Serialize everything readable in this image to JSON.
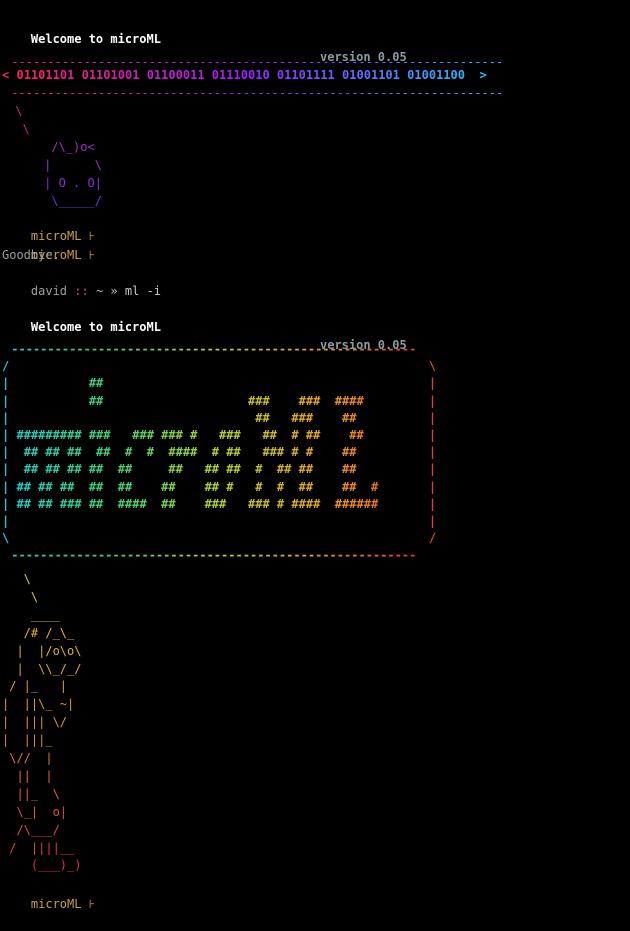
{
  "colors": {
    "background": "#000000",
    "text": "#c8c8c8",
    "prompt": "#c8a042",
    "version": "#8a9aa0",
    "banner_start": "#ff2060",
    "banner_mid": "#a020ff",
    "banner_end": "#20c0ff"
  },
  "session1": {
    "welcome": "Welcome to microML",
    "version": "version 0.05",
    "binary_line": "< 01101101 01101001 01100011 01110010 01101111 01001101 01001100  >",
    "dash_line": " --------------------------------------------------------------------",
    "cat_art": [
      " \\",
      "  \\",
      "      /\\_)o<",
      "     |      \\",
      "     | O . O|",
      "      \\_____/"
    ],
    "prompts": [
      {
        "name": "microML",
        "symbol": "⊦"
      },
      {
        "name": "microML",
        "symbol": "⊦"
      }
    ],
    "goodbye": "Goodbye.",
    "shell": {
      "user": "david",
      "sep": "::",
      "dir": "~",
      "arrow": "»",
      "command": "ml -i"
    }
  },
  "session2": {
    "welcome": "Welcome to microML",
    "version": "version 0.05",
    "box_top": " --------------------------------------------------------",
    "box_lines": [
      "/                                                          \\",
      "|           ##                                             |",
      "|           ##                    ###    ###  ####         |",
      "|                                  ##   ###    ##          |",
      "| ######### ###   ### ### #   ###   ##  # ##    ##         |",
      "|  ## ## ##  ##  #  #  ####  # ##   ### # #    ##          |",
      "|  ## ## ## ##  ##     ##   ## ##  #  ## ##    ##          |",
      "| ## ## ##  ##  ##    ##    ## #   #  #  ##    ##  #       |",
      "| ## ## ### ##  ####  ##    ###   ### # ####  ######       |",
      "|                                                          |",
      "\\                                                          /"
    ],
    "box_bottom": " --------------------------------------------------------",
    "robot_art": [
      "   \\",
      "    \\",
      "    ____",
      "   /# /_\\_",
      "  |  |/o\\o\\",
      "  |  \\\\_/_/",
      " / |_   |",
      "|  ||\\_ ~|",
      "|  ||| \\/",
      "|  |||_",
      " \\//  |",
      "  ||  |",
      "  ||_  \\",
      "  \\_|  o|",
      "  /\\___/",
      " /  ||||__",
      "    (___)_)"
    ],
    "prompt": {
      "name": "microML",
      "symbol": "⊦"
    }
  }
}
